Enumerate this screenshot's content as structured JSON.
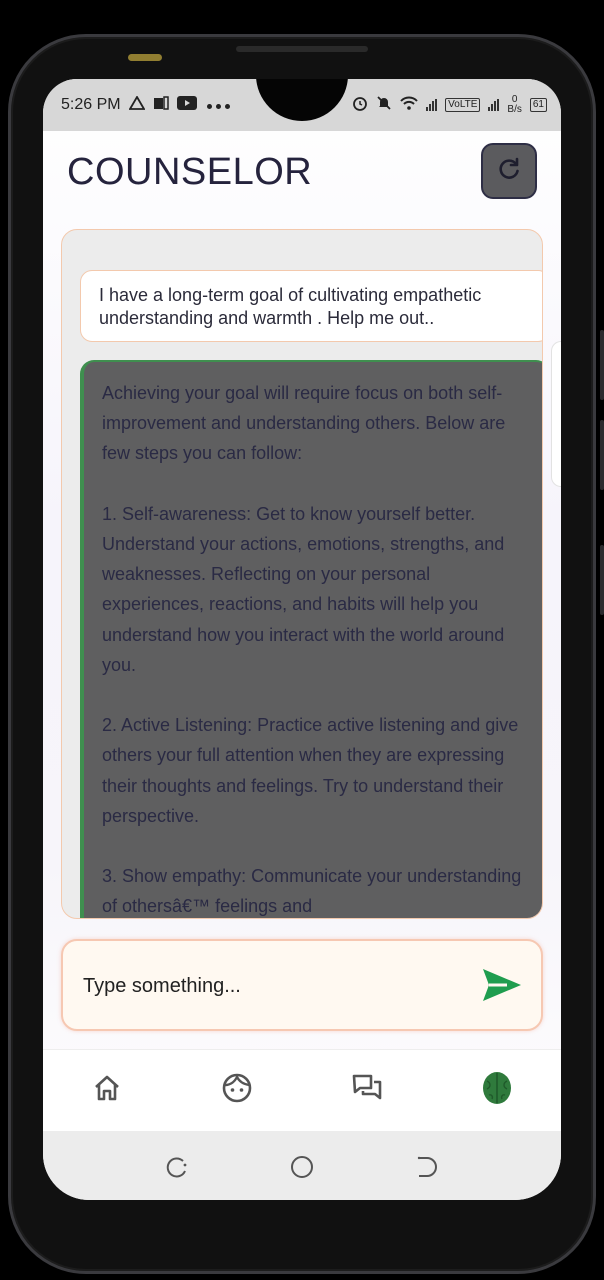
{
  "status_bar": {
    "time": "5:26 PM",
    "left_icons": [
      "alert-triangle-icon",
      "notification-icon",
      "youtube-icon",
      "more-dots-icon"
    ],
    "right_icons": [
      "alarm-icon",
      "mute-icon",
      "wifi-icon",
      "signal-icon",
      "volte-icon",
      "signal-icon",
      "net-speed",
      "battery-icon"
    ],
    "volte_label": "VoLTE",
    "net_speed_value": "0",
    "net_speed_unit": "B/s",
    "battery_level": "61"
  },
  "header": {
    "title": "COUNSELOR",
    "refresh_icon": "refresh-icon"
  },
  "chat": {
    "user_message": "I have a long-term goal of cultivating empathetic understanding and warmth . Help me out..",
    "bot_message": "Achieving your goal will require focus on both self-improvement and understanding others. Below are few steps you can follow:\n\n1. Self-awareness: Get to know yourself better. Understand your actions, emotions, strengths, and weaknesses. Reflecting on your personal experiences, reactions, and habits will help you understand how you interact with the world around you.\n\n2. Active Listening: Practice active listening and give others your full attention when they are expressing their thoughts and feelings. Try to understand their perspective.\n\n3. Show empathy: Communicate your understanding of othersâ€™ feelings and"
  },
  "input": {
    "placeholder": "Type something...",
    "send_icon": "send-icon"
  },
  "bottom_nav": {
    "items": [
      {
        "icon": "home-icon"
      },
      {
        "icon": "face-icon"
      },
      {
        "icon": "chat-bubbles-icon"
      },
      {
        "icon": "brain-icon"
      }
    ]
  },
  "system_nav": {
    "items": [
      "recents-icon",
      "home-circle-icon",
      "back-icon"
    ]
  },
  "colors": {
    "accent_green": "#1f9d4f",
    "card_border": "#f3c9ad",
    "bot_bubble": "#5f5f60",
    "title_color": "#25233d"
  }
}
